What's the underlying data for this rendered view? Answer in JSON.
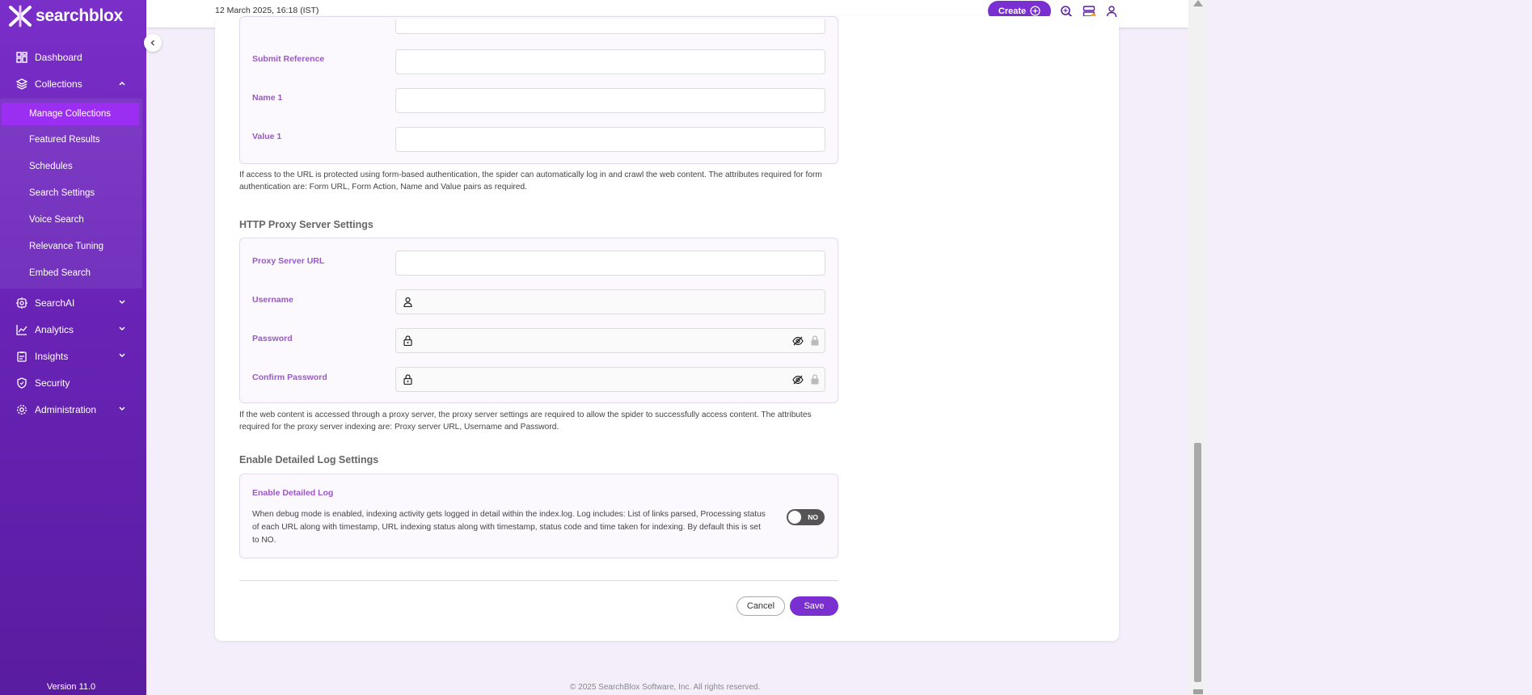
{
  "sidebar": {
    "brand": "searchblox",
    "items": [
      {
        "label": "Dashboard",
        "icon": "dashboard-icon"
      },
      {
        "label": "Collections",
        "icon": "layers-icon"
      },
      {
        "label": "SearchAI",
        "icon": "ai-icon"
      },
      {
        "label": "Analytics",
        "icon": "chart-icon"
      },
      {
        "label": "Insights",
        "icon": "clipboard-icon"
      },
      {
        "label": "Security",
        "icon": "shield-icon"
      },
      {
        "label": "Administration",
        "icon": "gear-icon"
      }
    ],
    "collections_sub": [
      "Manage Collections",
      "Featured Results",
      "Schedules",
      "Search Settings",
      "Voice Search",
      "Relevance Tuning",
      "Embed Search"
    ],
    "version": "Version 11.0"
  },
  "topbar": {
    "datetime": "12 March 2025, 16:18 (IST)",
    "create_label": "Create"
  },
  "form_auth": {
    "fields": [
      {
        "label": "Submit Reference",
        "value": ""
      },
      {
        "label": "Name 1",
        "value": ""
      },
      {
        "label": "Value 1",
        "value": ""
      }
    ],
    "help": "If access to the URL is protected using form-based authentication, the spider can automatically log in and crawl the web content. The attributes required for form authentication are: Form URL, Form Action, Name and Value pairs as required."
  },
  "proxy": {
    "title": "HTTP Proxy Server Settings",
    "fields": [
      {
        "label": "Proxy Server URL",
        "value": ""
      },
      {
        "label": "Username",
        "value": ""
      },
      {
        "label": "Password",
        "value": ""
      },
      {
        "label": "Confirm Password",
        "value": ""
      }
    ],
    "help": "If the web content is accessed through a proxy server, the proxy server settings are required to allow the spider to successfully access content. The attributes required for the proxy server indexing are: Proxy server URL, Username and Password."
  },
  "log": {
    "title": "Enable Detailed Log Settings",
    "label": "Enable Detailed Log",
    "description": "When debug mode is enabled, indexing activity gets logged in detail within the index.log. Log includes: List of links parsed, Processing status of each URL along with timestamp, URL indexing status along with timestamp, status code and time taken for indexing. By default this is set to NO.",
    "toggle": "NO"
  },
  "actions": {
    "cancel": "Cancel",
    "save": "Save"
  },
  "footer": "© 2025 SearchBlox Software, Inc. All rights reserved.",
  "colors": {
    "accent": "#7a2fd0",
    "label": "#9b57c7",
    "active_sub": "#9b2ef0"
  }
}
